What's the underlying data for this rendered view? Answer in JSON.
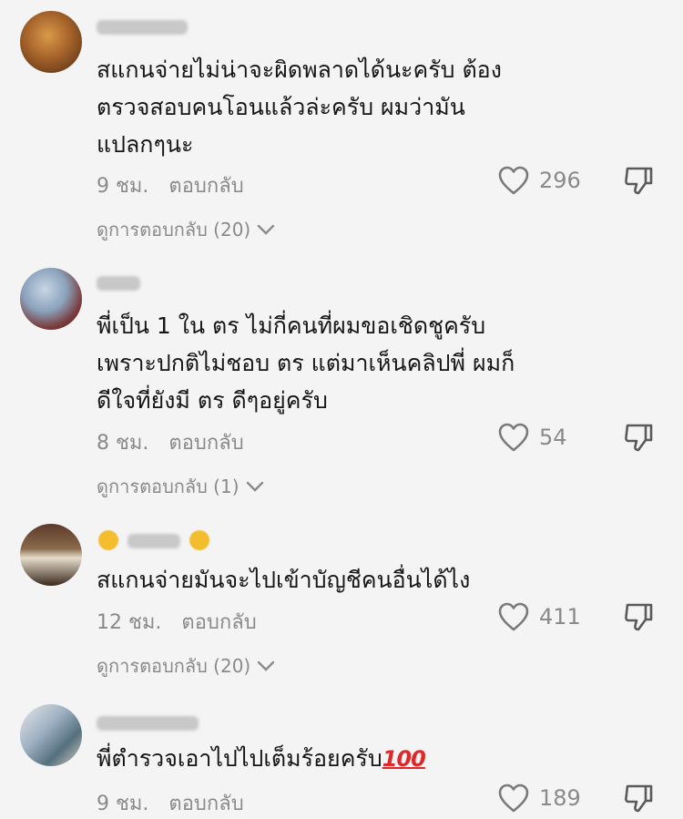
{
  "comments": [
    {
      "text_lines": [
        "สแกนจ่ายไม่น่าจะผิดพลาดได้นะครับ ต้อง",
        "ตรวจสอบคนโอนแล้วล่ะครับ ผมว่ามัน",
        "แปลกๆนะ"
      ],
      "time": "9 ชม.",
      "reply_label": "ตอบกลับ",
      "likes": "296",
      "view_replies": "ดูการตอบกลับ (20)"
    },
    {
      "text_lines": [
        "พี่เป็น 1 ใน ตร ไม่กี่คนที่ผมขอเชิดชูครับ",
        "เพราะปกติไม่ชอบ ตร แต่มาเห็นคลิปพี่ ผมก็",
        "ดีใจที่ยังมี ตร ดีๆอยู่ครับ"
      ],
      "time": "8 ชม.",
      "reply_label": "ตอบกลับ",
      "likes": "54",
      "view_replies": "ดูการตอบกลับ (1)"
    },
    {
      "text_lines": [
        "สแกนจ่ายมันจะไปเข้าบัญชีคนอื่นได้ไง"
      ],
      "time": "12 ชม.",
      "reply_label": "ตอบกลับ",
      "likes": "411",
      "view_replies": "ดูการตอบกลับ (20)"
    },
    {
      "text_lines": [
        "พี่ตำรวจเอาไปไปเต็มร้อยครับ"
      ],
      "emoji": "100",
      "time": "9 ชม.",
      "reply_label": "ตอบกลับ",
      "likes": "189"
    }
  ],
  "icons": {
    "like": "heart-outline-icon",
    "dislike": "thumbs-down-icon",
    "expand": "chevron-down-icon"
  }
}
